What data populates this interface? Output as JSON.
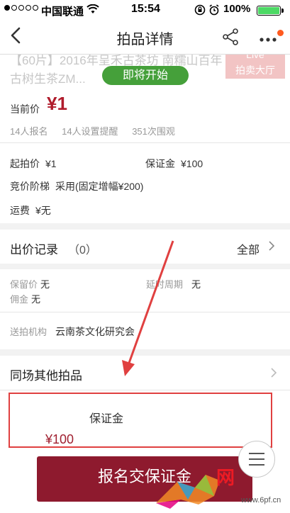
{
  "status_bar": {
    "carrier": "中国联通",
    "time": "15:54",
    "battery_pct": "100%",
    "signal_filled": 1,
    "signal_total": 5
  },
  "nav": {
    "back_icon": "chevron-left-icon",
    "title": "拍品详情",
    "share_icon": "share-icon",
    "more_icon": "more-dots-icon"
  },
  "product": {
    "name": "【60片】2016年呈禾古茶坊 南糯山百年古树生茶ZM...",
    "live_top": "Live",
    "live_label": "拍卖大厅",
    "status_pill": "即将开始"
  },
  "price": {
    "label": "当前价",
    "value": "¥1",
    "stats": [
      "14人报名",
      "14人设置提醒",
      "351次围观"
    ]
  },
  "terms": {
    "start_label": "起拍价",
    "start_value": "¥1",
    "deposit_label": "保证金",
    "deposit_value": "¥100",
    "ladder_label": "竞价阶梯",
    "ladder_value": "采用(固定增幅¥200)",
    "ship_label": "运费",
    "ship_value": "¥无"
  },
  "bid_record": {
    "label": "出价记录",
    "count": "（0）",
    "all_label": "全部"
  },
  "details": {
    "reserve_label": "保留价",
    "reserve_value": "无",
    "delay_label": "延时周期",
    "delay_value": "无",
    "commission_label": "佣金",
    "commission_value": "无",
    "sender_label": "送拍机构",
    "sender_value": "云南茶文化研究会"
  },
  "others": {
    "label": "同场其他拍品"
  },
  "deposit_popup": {
    "title": "保证金",
    "amount": "¥100"
  },
  "signup_button": {
    "label": "报名交保证金"
  },
  "watermark": {
    "text": "网",
    "url": "www.6pf.cn"
  },
  "colors": {
    "accent": "#8e1a2e",
    "price_red": "#b01c2c",
    "pill_green": "#45a03a",
    "annotation_red": "#e04040"
  }
}
